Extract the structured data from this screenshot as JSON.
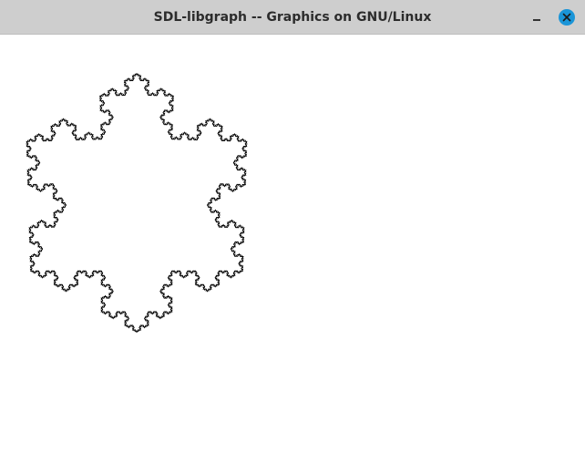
{
  "window": {
    "title": "SDL-libgraph -- Graphics on GNU/Linux",
    "close_button_color": "#1a95d8"
  },
  "titlebar_buttons": {
    "minimize_icon": "minimize-icon",
    "close_icon": "close-icon"
  },
  "drawing": {
    "shape": "koch-snowflake",
    "iterations": 5,
    "stroke_color": "#000000",
    "background_color": "#ffffff"
  }
}
